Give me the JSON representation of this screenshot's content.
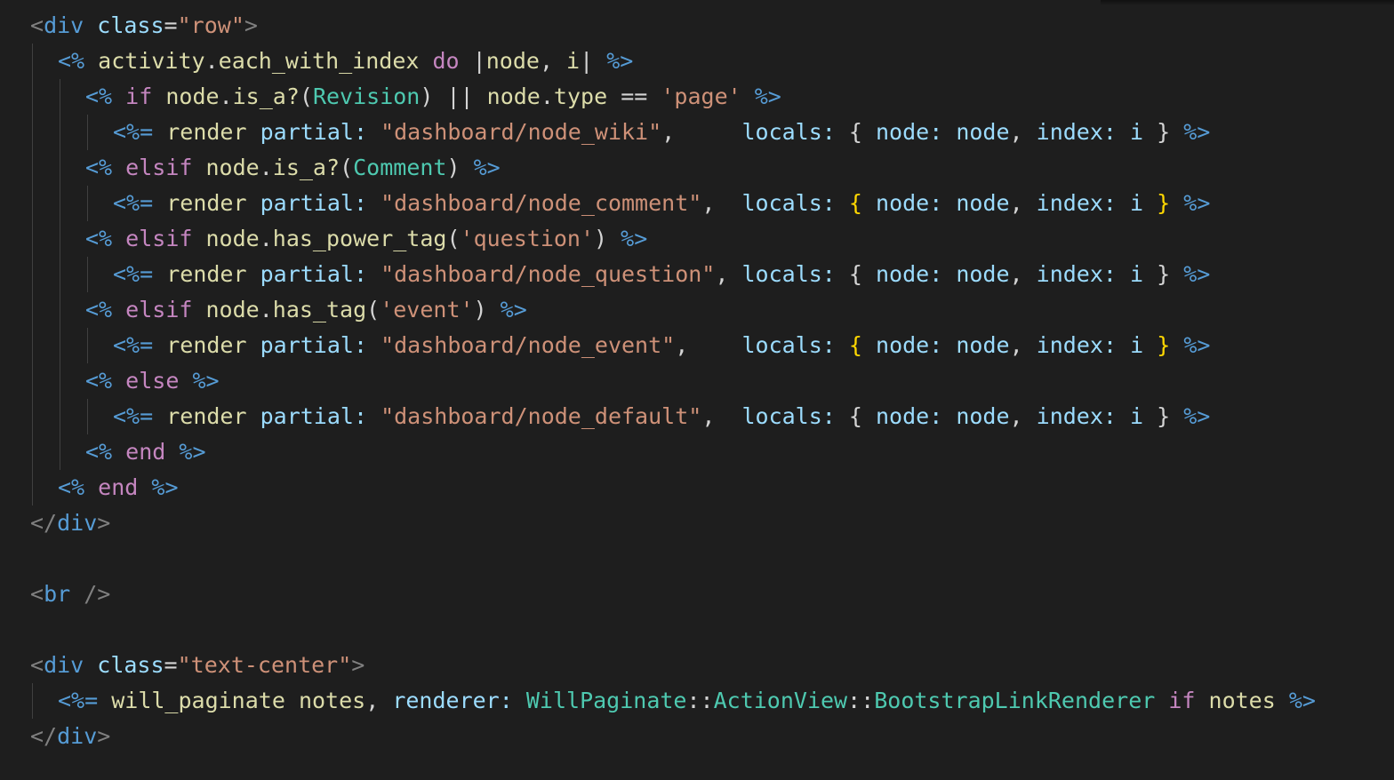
{
  "editor": {
    "background": "#1e1e1e",
    "colors": {
      "tag": "#808080",
      "tagname": "#569cd6",
      "attr": "#9cdcfe",
      "string": "#ce9178",
      "erb": "#569cd6",
      "keyword": "#c586c0",
      "func": "#dcdcaa",
      "var": "#9cdcfe",
      "cls": "#4ec9b0",
      "plain": "#d4d4d4",
      "brace": "#ffd700"
    },
    "lines": [
      {
        "indent": 0,
        "tokens": [
          [
            "tag",
            "<"
          ],
          [
            "tagname",
            "div"
          ],
          [
            "plain",
            " "
          ],
          [
            "attr",
            "class"
          ],
          [
            "plain",
            "="
          ],
          [
            "string",
            "\"row\""
          ],
          [
            "tag",
            ">"
          ]
        ]
      },
      {
        "indent": 1,
        "tokens": [
          [
            "erb",
            "<%"
          ],
          [
            "plain",
            " "
          ],
          [
            "func",
            "activity"
          ],
          [
            "plain",
            "."
          ],
          [
            "func",
            "each_with_index"
          ],
          [
            "plain",
            " "
          ],
          [
            "keyword",
            "do"
          ],
          [
            "plain",
            " |"
          ],
          [
            "func",
            "node"
          ],
          [
            "plain",
            ", "
          ],
          [
            "func",
            "i"
          ],
          [
            "plain",
            "| "
          ],
          [
            "erb",
            "%>"
          ]
        ]
      },
      {
        "indent": 2,
        "tokens": [
          [
            "erb",
            "<%"
          ],
          [
            "plain",
            " "
          ],
          [
            "keyword",
            "if"
          ],
          [
            "plain",
            " "
          ],
          [
            "func",
            "node"
          ],
          [
            "plain",
            "."
          ],
          [
            "func",
            "is_a?"
          ],
          [
            "plain",
            "("
          ],
          [
            "cls",
            "Revision"
          ],
          [
            "plain",
            ") || "
          ],
          [
            "func",
            "node"
          ],
          [
            "plain",
            "."
          ],
          [
            "func",
            "type"
          ],
          [
            "plain",
            " == "
          ],
          [
            "string",
            "'page'"
          ],
          [
            "plain",
            " "
          ],
          [
            "erb",
            "%>"
          ]
        ]
      },
      {
        "indent": 3,
        "tokens": [
          [
            "erb",
            "<%="
          ],
          [
            "plain",
            " "
          ],
          [
            "func",
            "render"
          ],
          [
            "plain",
            " "
          ],
          [
            "attr",
            "partial:"
          ],
          [
            "plain",
            " "
          ],
          [
            "string",
            "\"dashboard/node_wiki\""
          ],
          [
            "plain",
            ",     "
          ],
          [
            "attr",
            "locals:"
          ],
          [
            "plain",
            " { "
          ],
          [
            "attr",
            "node:"
          ],
          [
            "plain",
            " "
          ],
          [
            "var",
            "node"
          ],
          [
            "plain",
            ", "
          ],
          [
            "attr",
            "index:"
          ],
          [
            "plain",
            " "
          ],
          [
            "var",
            "i"
          ],
          [
            "plain",
            " } "
          ],
          [
            "erb",
            "%>"
          ]
        ]
      },
      {
        "indent": 2,
        "tokens": [
          [
            "erb",
            "<%"
          ],
          [
            "plain",
            " "
          ],
          [
            "keyword",
            "elsif"
          ],
          [
            "plain",
            " "
          ],
          [
            "func",
            "node"
          ],
          [
            "plain",
            "."
          ],
          [
            "func",
            "is_a?"
          ],
          [
            "plain",
            "("
          ],
          [
            "cls",
            "Comment"
          ],
          [
            "plain",
            ") "
          ],
          [
            "erb",
            "%>"
          ]
        ]
      },
      {
        "indent": 3,
        "tokens": [
          [
            "erb",
            "<%="
          ],
          [
            "plain",
            " "
          ],
          [
            "func",
            "render"
          ],
          [
            "plain",
            " "
          ],
          [
            "attr",
            "partial:"
          ],
          [
            "plain",
            " "
          ],
          [
            "string",
            "\"dashboard/node_comment\""
          ],
          [
            "plain",
            ",  "
          ],
          [
            "attr",
            "locals:"
          ],
          [
            "plain",
            " "
          ],
          [
            "brace",
            "{"
          ],
          [
            "plain",
            " "
          ],
          [
            "attr",
            "node:"
          ],
          [
            "plain",
            " "
          ],
          [
            "var",
            "node"
          ],
          [
            "plain",
            ", "
          ],
          [
            "attr",
            "index:"
          ],
          [
            "plain",
            " "
          ],
          [
            "var",
            "i"
          ],
          [
            "plain",
            " "
          ],
          [
            "brace",
            "}"
          ],
          [
            "plain",
            " "
          ],
          [
            "erb",
            "%>"
          ]
        ]
      },
      {
        "indent": 2,
        "tokens": [
          [
            "erb",
            "<%"
          ],
          [
            "plain",
            " "
          ],
          [
            "keyword",
            "elsif"
          ],
          [
            "plain",
            " "
          ],
          [
            "func",
            "node"
          ],
          [
            "plain",
            "."
          ],
          [
            "func",
            "has_power_tag"
          ],
          [
            "plain",
            "("
          ],
          [
            "string",
            "'question'"
          ],
          [
            "plain",
            ") "
          ],
          [
            "erb",
            "%>"
          ]
        ]
      },
      {
        "indent": 3,
        "tokens": [
          [
            "erb",
            "<%="
          ],
          [
            "plain",
            " "
          ],
          [
            "func",
            "render"
          ],
          [
            "plain",
            " "
          ],
          [
            "attr",
            "partial:"
          ],
          [
            "plain",
            " "
          ],
          [
            "string",
            "\"dashboard/node_question\""
          ],
          [
            "plain",
            ", "
          ],
          [
            "attr",
            "locals:"
          ],
          [
            "plain",
            " { "
          ],
          [
            "attr",
            "node:"
          ],
          [
            "plain",
            " "
          ],
          [
            "var",
            "node"
          ],
          [
            "plain",
            ", "
          ],
          [
            "attr",
            "index:"
          ],
          [
            "plain",
            " "
          ],
          [
            "var",
            "i"
          ],
          [
            "plain",
            " } "
          ],
          [
            "erb",
            "%>"
          ]
        ]
      },
      {
        "indent": 2,
        "tokens": [
          [
            "erb",
            "<%"
          ],
          [
            "plain",
            " "
          ],
          [
            "keyword",
            "elsif"
          ],
          [
            "plain",
            " "
          ],
          [
            "func",
            "node"
          ],
          [
            "plain",
            "."
          ],
          [
            "func",
            "has_tag"
          ],
          [
            "plain",
            "("
          ],
          [
            "string",
            "'event'"
          ],
          [
            "plain",
            ") "
          ],
          [
            "erb",
            "%>"
          ]
        ]
      },
      {
        "indent": 3,
        "tokens": [
          [
            "erb",
            "<%="
          ],
          [
            "plain",
            " "
          ],
          [
            "func",
            "render"
          ],
          [
            "plain",
            " "
          ],
          [
            "attr",
            "partial:"
          ],
          [
            "plain",
            " "
          ],
          [
            "string",
            "\"dashboard/node_event\""
          ],
          [
            "plain",
            ",    "
          ],
          [
            "attr",
            "locals:"
          ],
          [
            "plain",
            " "
          ],
          [
            "brace",
            "{"
          ],
          [
            "plain",
            " "
          ],
          [
            "attr",
            "node:"
          ],
          [
            "plain",
            " "
          ],
          [
            "var",
            "node"
          ],
          [
            "plain",
            ", "
          ],
          [
            "attr",
            "index:"
          ],
          [
            "plain",
            " "
          ],
          [
            "var",
            "i"
          ],
          [
            "plain",
            " "
          ],
          [
            "brace",
            "}"
          ],
          [
            "plain",
            " "
          ],
          [
            "erb",
            "%>"
          ]
        ]
      },
      {
        "indent": 2,
        "tokens": [
          [
            "erb",
            "<%"
          ],
          [
            "plain",
            " "
          ],
          [
            "keyword",
            "else"
          ],
          [
            "plain",
            " "
          ],
          [
            "erb",
            "%>"
          ]
        ]
      },
      {
        "indent": 3,
        "tokens": [
          [
            "erb",
            "<%="
          ],
          [
            "plain",
            " "
          ],
          [
            "func",
            "render"
          ],
          [
            "plain",
            " "
          ],
          [
            "attr",
            "partial:"
          ],
          [
            "plain",
            " "
          ],
          [
            "string",
            "\"dashboard/node_default\""
          ],
          [
            "plain",
            ",  "
          ],
          [
            "attr",
            "locals:"
          ],
          [
            "plain",
            " { "
          ],
          [
            "attr",
            "node:"
          ],
          [
            "plain",
            " "
          ],
          [
            "var",
            "node"
          ],
          [
            "plain",
            ", "
          ],
          [
            "attr",
            "index:"
          ],
          [
            "plain",
            " "
          ],
          [
            "var",
            "i"
          ],
          [
            "plain",
            " } "
          ],
          [
            "erb",
            "%>"
          ]
        ]
      },
      {
        "indent": 2,
        "tokens": [
          [
            "erb",
            "<%"
          ],
          [
            "plain",
            " "
          ],
          [
            "keyword",
            "end"
          ],
          [
            "plain",
            " "
          ],
          [
            "erb",
            "%>"
          ]
        ]
      },
      {
        "indent": 1,
        "tokens": [
          [
            "erb",
            "<%"
          ],
          [
            "plain",
            " "
          ],
          [
            "keyword",
            "end"
          ],
          [
            "plain",
            " "
          ],
          [
            "erb",
            "%>"
          ]
        ]
      },
      {
        "indent": 0,
        "tokens": [
          [
            "tag",
            "</"
          ],
          [
            "tagname",
            "div"
          ],
          [
            "tag",
            ">"
          ]
        ]
      },
      {
        "indent": 0,
        "tokens": []
      },
      {
        "indent": 0,
        "tokens": [
          [
            "tag",
            "<"
          ],
          [
            "tagname",
            "br"
          ],
          [
            "plain",
            " "
          ],
          [
            "tag",
            "/>"
          ]
        ]
      },
      {
        "indent": 0,
        "tokens": []
      },
      {
        "indent": 0,
        "tokens": [
          [
            "tag",
            "<"
          ],
          [
            "tagname",
            "div"
          ],
          [
            "plain",
            " "
          ],
          [
            "attr",
            "class"
          ],
          [
            "plain",
            "="
          ],
          [
            "string",
            "\"text-center\""
          ],
          [
            "tag",
            ">"
          ]
        ]
      },
      {
        "indent": 1,
        "tokens": [
          [
            "erb",
            "<%="
          ],
          [
            "plain",
            " "
          ],
          [
            "func",
            "will_paginate"
          ],
          [
            "plain",
            " "
          ],
          [
            "func",
            "notes"
          ],
          [
            "plain",
            ", "
          ],
          [
            "attr",
            "renderer:"
          ],
          [
            "plain",
            " "
          ],
          [
            "cls",
            "WillPaginate"
          ],
          [
            "plain",
            "::"
          ],
          [
            "cls",
            "ActionView"
          ],
          [
            "plain",
            "::"
          ],
          [
            "cls",
            "BootstrapLinkRenderer"
          ],
          [
            "plain",
            " "
          ],
          [
            "keyword",
            "if"
          ],
          [
            "plain",
            " "
          ],
          [
            "func",
            "notes"
          ],
          [
            "plain",
            " "
          ],
          [
            "erb",
            "%>"
          ]
        ]
      },
      {
        "indent": 0,
        "tokens": [
          [
            "tag",
            "</"
          ],
          [
            "tagname",
            "div"
          ],
          [
            "tag",
            ">"
          ]
        ]
      }
    ]
  }
}
